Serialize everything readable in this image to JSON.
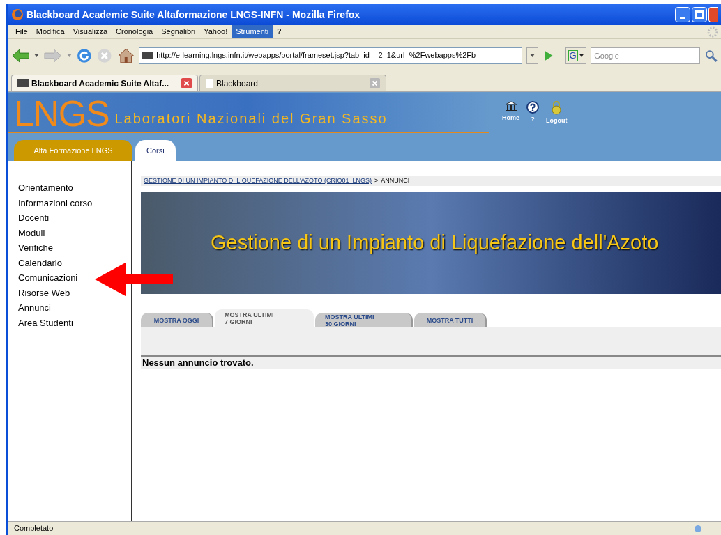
{
  "window": {
    "title": "Blackboard Academic Suite Altaformazione LNGS-INFN - Mozilla Firefox"
  },
  "menu": [
    {
      "label": "File",
      "selected": false
    },
    {
      "label": "Modifica",
      "selected": false
    },
    {
      "label": "Visualizza",
      "selected": false
    },
    {
      "label": "Cronologia",
      "selected": false
    },
    {
      "label": "Segnalibri",
      "selected": false
    },
    {
      "label": "Yahoo!",
      "selected": false
    },
    {
      "label": "Strumenti",
      "selected": true
    },
    {
      "label": "?",
      "selected": false
    }
  ],
  "address_bar": {
    "value": "http://e-learning.lngs.infn.it/webapps/portal/frameset.jsp?tab_id=_2_1&url=%2Fwebapps%2Fb"
  },
  "search": {
    "engine": "G",
    "placeholder": "Google"
  },
  "browser_tabs": [
    {
      "label": "Blackboard Academic Suite Altaf...",
      "selected": true
    },
    {
      "label": "Blackboard",
      "selected": false
    }
  ],
  "site_header": {
    "logo": "LNGS",
    "subtitle": "Laboratori Nazionali del Gran Sasso",
    "links": [
      "Home",
      "?",
      "Logout"
    ]
  },
  "site_tabs": [
    {
      "label": "Alta Formazione LNGS",
      "selected": false
    },
    {
      "label": "Corsi",
      "selected": true
    }
  ],
  "sidebar": {
    "items": [
      "Orientamento",
      "Informazioni corso",
      "Docenti",
      "Moduli",
      "Verifiche",
      "Calendario",
      "Comunicazioni",
      "Risorse Web",
      "Annunci",
      "Area Studenti"
    ]
  },
  "breadcrumb": {
    "link": "GESTIONE DI UN IMPIANTO DI LIQUEFAZIONE DELL'AZOTO (CRIO01_LNGS)",
    "separator": ">",
    "current": "ANNUNCI"
  },
  "banner": {
    "title": "Gestione di un Impianto di Liquefazione dell'Azoto"
  },
  "announcement_tabs": [
    {
      "lines": [
        "MOSTRA OGGI"
      ],
      "selected": false
    },
    {
      "lines": [
        "MOSTRA ULTIMI",
        "7 GIORNI"
      ],
      "selected": true
    },
    {
      "lines": [
        "MOSTRA ULTIMI",
        "30 GIORNI"
      ],
      "selected": false
    },
    {
      "lines": [
        "MOSTRA TUTTI"
      ],
      "selected": false
    }
  ],
  "message": "Nessun annuncio trovato.",
  "status_bar": {
    "text": "Completato"
  }
}
